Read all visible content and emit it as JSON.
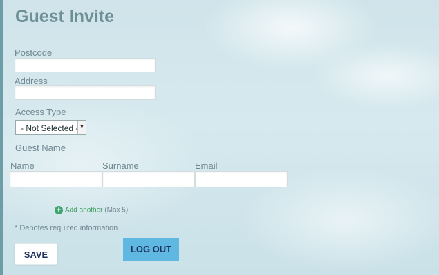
{
  "page": {
    "title": "Guest Invite"
  },
  "form": {
    "postcode": {
      "label": "Postcode",
      "value": ""
    },
    "address": {
      "label": "Address",
      "value": ""
    },
    "access_type": {
      "label": "Access Type",
      "selected": "- Not Selected -"
    },
    "guest_name": {
      "heading": "Guest Name",
      "columns": [
        "Name",
        "Surname",
        "Email"
      ]
    },
    "add_another": {
      "label": "Add another",
      "note": "(Max 5)"
    },
    "required_note": "* Denotes required information"
  },
  "buttons": {
    "save": "SAVE",
    "logout": "LOG OUT"
  },
  "colors": {
    "accent_logout": "#5fb8e2",
    "title": "#6f8f96",
    "add_link": "#3c9c5d"
  }
}
